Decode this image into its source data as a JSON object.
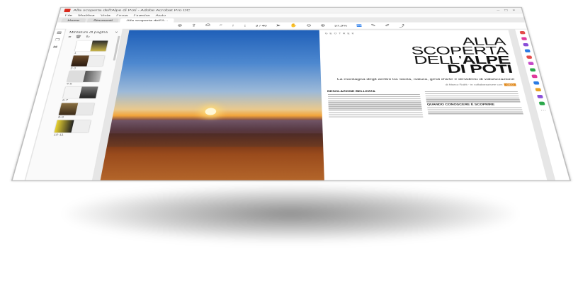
{
  "window": {
    "title": "Alla scoperta dell'Alpe di Poti - Adobe Acrobat Pro DC",
    "controls": {
      "minimize": "–",
      "maximize": "□",
      "close": "×"
    }
  },
  "menu": [
    "File",
    "Modifica",
    "Vista",
    "Firma",
    "Finestra",
    "Aiuto"
  ],
  "tabs": [
    {
      "label": "Home"
    },
    {
      "label": "Strumenti"
    },
    {
      "label": "Alla scoperta dell'A...",
      "active": true
    }
  ],
  "toolbar": {
    "page_indicator": "3 / 40",
    "zoom": "37,9%"
  },
  "sidebar": {
    "title": "Miniature di pagina",
    "close": "×",
    "thumb_numbers": [
      "1",
      "2-3",
      "4-5",
      "6-7",
      "8-9",
      "10-11"
    ]
  },
  "article": {
    "kicker": "G E O T R E K",
    "headline": {
      "line1": "ALLA",
      "line2": "SCOPERTA",
      "line3_light": "DELL'",
      "line3_bold": "ALPE",
      "line4": "DI POTI"
    },
    "subhead": "La montagna degli aretini tra storia, natura, gesti d'arte e desiderio di valorizzazione",
    "byline": "di Marco Rubli · in collaborazione con",
    "badge": "GEO",
    "section1": "DESOLAZIONE BELLEZZA",
    "section2": "QUANDO CONOSCERE È SCOPRIRE"
  },
  "colors": {
    "accent": "#1a73e8",
    "acrobat_red": "#d9291c",
    "badge": "#e08a1e"
  },
  "right_tools": [
    "#e34b4b",
    "#e0399b",
    "#8a4fd8",
    "#2a7be4",
    "#e34b4b",
    "#c447c8",
    "#2aa84a",
    "#e0399b",
    "#2a7be4",
    "#e8a021",
    "#8a4fd8",
    "#2aa84a"
  ]
}
